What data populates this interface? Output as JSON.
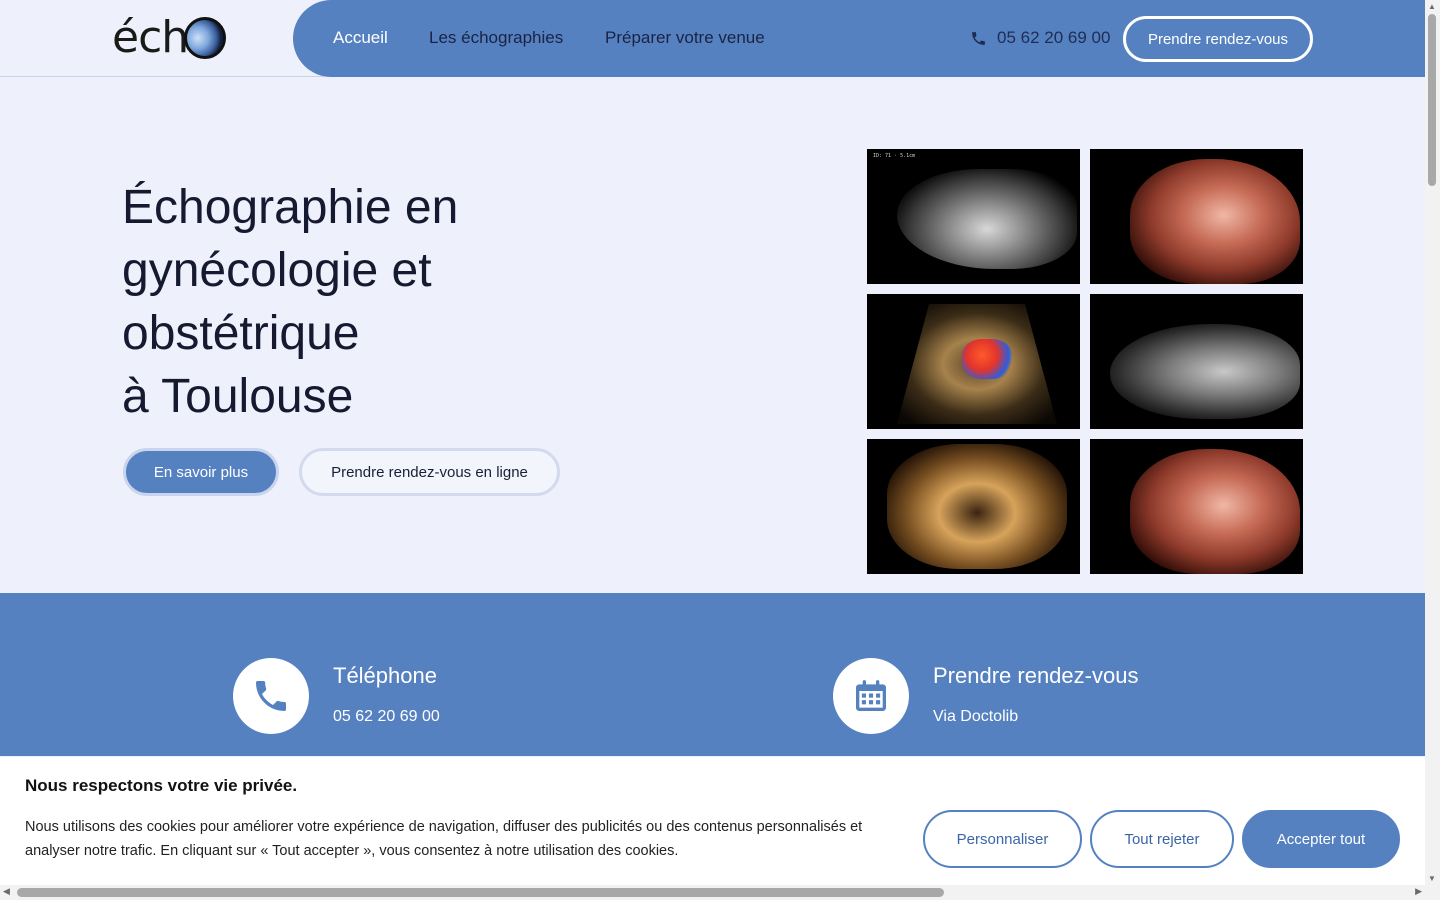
{
  "header": {
    "logo": "éch",
    "nav": [
      {
        "label": "Accueil"
      },
      {
        "label": "Les échographies"
      },
      {
        "label": "Préparer votre venue"
      }
    ],
    "phone": "05 62 20 69 00",
    "cta": "Prendre rendez-vous"
  },
  "hero": {
    "title_lines": [
      "Échographie en",
      "gynécologie et",
      "obstétrique",
      "à Toulouse"
    ],
    "primary_button": "En savoir plus",
    "secondary_button": "Prendre rendez-vous en ligne",
    "gallery": [
      {
        "icon": "ultrasound-image-grey-profile"
      },
      {
        "icon": "ultrasound-image-3d-face"
      },
      {
        "icon": "ultrasound-image-doppler-heart"
      },
      {
        "icon": "ultrasound-image-grey-fetus"
      },
      {
        "icon": "ultrasound-image-3d-uterus"
      },
      {
        "icon": "ultrasound-image-3d-face-close"
      }
    ]
  },
  "contact": {
    "phone_title": "Téléphone",
    "phone_value": "05 62 20 69 00",
    "rdv_title": "Prendre rendez-vous",
    "rdv_value": "Via Doctolib"
  },
  "cookie": {
    "title": "Nous respectons votre vie privée.",
    "text": "Nous utilisons des cookies pour améliorer votre expérience de navigation, diffuser des publicités ou des contenus personnalisés et analyser notre trafic. En cliquant sur « Tout accepter », vous consentez à notre utilisation des cookies.",
    "customize": "Personnaliser",
    "reject": "Tout rejeter",
    "accept": "Accepter tout"
  },
  "colors": {
    "brand_blue": "#5581c1",
    "page_bg": "#eef1fb",
    "dark_text": "#151a30"
  }
}
